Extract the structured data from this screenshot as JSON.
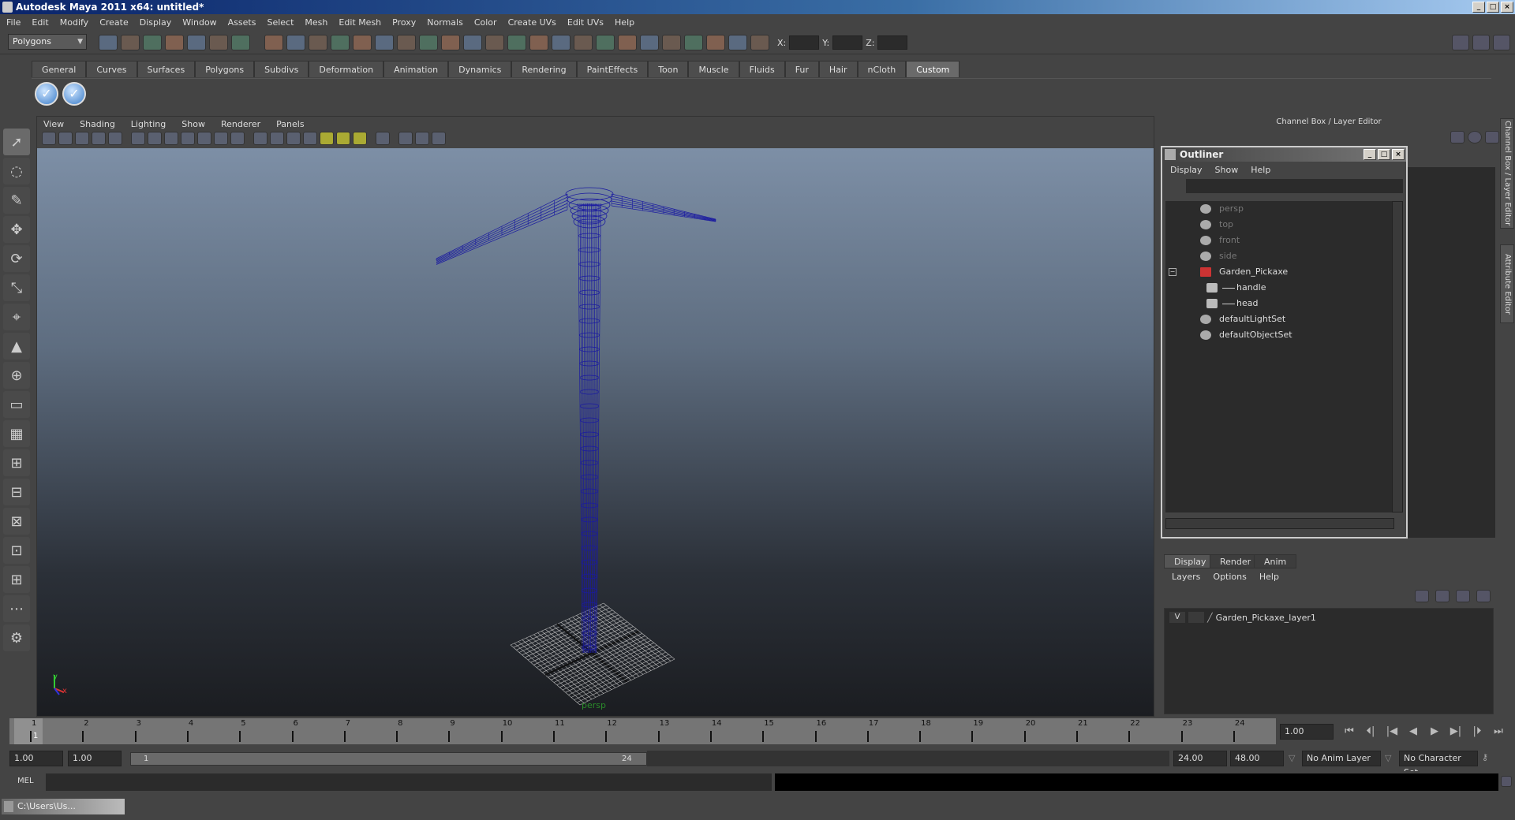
{
  "window": {
    "title": "Autodesk Maya 2011 x64: untitled*"
  },
  "menubar": [
    "File",
    "Edit",
    "Modify",
    "Create",
    "Display",
    "Window",
    "Assets",
    "Select",
    "Mesh",
    "Edit Mesh",
    "Proxy",
    "Normals",
    "Color",
    "Create UVs",
    "Edit UVs",
    "Help"
  ],
  "toolbar": {
    "mode": "Polygons",
    "x_label": "X:",
    "y_label": "Y:",
    "z_label": "Z:",
    "icons": [
      "new-scene-icon",
      "open-scene-icon",
      "save-scene-icon",
      "select-hierarchy-icon",
      "select-object-icon",
      "select-component-icon",
      "filter-icon",
      "select-handles-icon",
      "select-joints-icon",
      "select-curves-icon",
      "select-surfaces-icon",
      "select-deformations-icon",
      "select-dynamics-icon",
      "select-rendering-icon",
      "select-misc-icon",
      "lock-icon",
      "highlight-selection-icon",
      "snap-grid-icon",
      "snap-curve-icon",
      "snap-point-icon",
      "snap-view-plane-icon",
      "make-live-icon",
      "input-ops-icon",
      "output-ops-icon",
      "construction-history-icon",
      "render-view-icon",
      "render-icon",
      "ipr-render-icon",
      "render-settings-icon",
      "transform-icon"
    ]
  },
  "shelf": {
    "tabs": [
      "General",
      "Curves",
      "Surfaces",
      "Polygons",
      "Subdivs",
      "Deformation",
      "Animation",
      "Dynamics",
      "Rendering",
      "PaintEffects",
      "Toon",
      "Muscle",
      "Fluids",
      "Fur",
      "Hair",
      "nCloth",
      "Custom"
    ],
    "active": "Custom",
    "buttons": [
      "check-icon",
      "check-icon"
    ]
  },
  "tools": [
    "select-tool-icon",
    "lasso-tool-icon",
    "paint-select-icon",
    "move-tool-icon",
    "rotate-tool-icon",
    "scale-tool-icon",
    "universal-manipulator-icon",
    "soft-mod-icon",
    "show-manipulator-icon",
    "last-tool-icon",
    "single-perspective-layout-icon",
    "four-view-layout-icon",
    "persp-outliner-layout-icon",
    "persp-graph-layout-icon",
    "outliner-persp-layout-icon",
    "persp-hypershade-layout-icon",
    "more-layouts-icon",
    "script-editor-icon"
  ],
  "viewport": {
    "menus": [
      "View",
      "Shading",
      "Lighting",
      "Show",
      "Renderer",
      "Panels"
    ],
    "camera_label": "persp",
    "axis": {
      "y": "y",
      "x": "x"
    },
    "icons": [
      "select-camera-icon",
      "camera-attributes-icon",
      "bookmarks-icon",
      "image-plane-icon",
      "2d-pan-zoom-icon",
      "grid-icon",
      "film-gate-icon",
      "resolution-gate-icon",
      "gate-mask-icon",
      "field-chart-icon",
      "safe-action-icon",
      "safe-title-icon",
      "wireframe-icon",
      "smooth-shade-icon",
      "smooth-wireframe-icon",
      "textured-icon",
      "default-lighting-icon",
      "all-lights-icon",
      "shadows-icon",
      "isolate-select-icon",
      "xray-icon",
      "xray-joints-icon",
      "component-xray-icon"
    ],
    "mesh_color": "#1a1aa0"
  },
  "channel_box": {
    "title": "Channel Box / Layer Editor"
  },
  "side_tabs": [
    "Channel Box / Layer Editor",
    "Attribute Editor"
  ],
  "outliner": {
    "title": "Outliner",
    "menus": [
      "Display",
      "Show",
      "Help"
    ],
    "items": [
      {
        "label": "persp",
        "type": "camera",
        "dim": true
      },
      {
        "label": "top",
        "type": "camera",
        "dim": true
      },
      {
        "label": "front",
        "type": "camera",
        "dim": true
      },
      {
        "label": "side",
        "type": "camera",
        "dim": true
      },
      {
        "label": "Garden_Pickaxe",
        "type": "group",
        "expanded": true
      },
      {
        "label": "handle",
        "type": "mesh",
        "child": true
      },
      {
        "label": "head",
        "type": "mesh",
        "child": true
      },
      {
        "label": "defaultLightSet",
        "type": "set"
      },
      {
        "label": "defaultObjectSet",
        "type": "set"
      }
    ]
  },
  "layer_editor": {
    "tabs": [
      "Display",
      "Render",
      "Anim"
    ],
    "active": "Display",
    "menus": [
      "Layers",
      "Options",
      "Help"
    ],
    "layers": [
      {
        "visible": "V",
        "name": "Garden_Pickaxe_layer1"
      }
    ]
  },
  "timeline": {
    "start": 1,
    "end": 24,
    "current": 1,
    "current_field": "1.00",
    "playback": [
      "go-to-start-icon",
      "step-back-key-icon",
      "step-back-frame-icon",
      "play-backward-icon",
      "play-forward-icon",
      "step-forward-frame-icon",
      "step-forward-key-icon",
      "go-to-end-icon"
    ]
  },
  "range": {
    "start_time": "1.00",
    "playback_start": "1.00",
    "range_min": "1",
    "range_max": "24",
    "playback_end": "24.00",
    "end_time": "48.00",
    "anim_layer": "No Anim Layer",
    "character_set": "No Character Set"
  },
  "command_line": {
    "label": "MEL",
    "value": ""
  },
  "taskbar": {
    "window": "C:\\Users\\Us..."
  }
}
